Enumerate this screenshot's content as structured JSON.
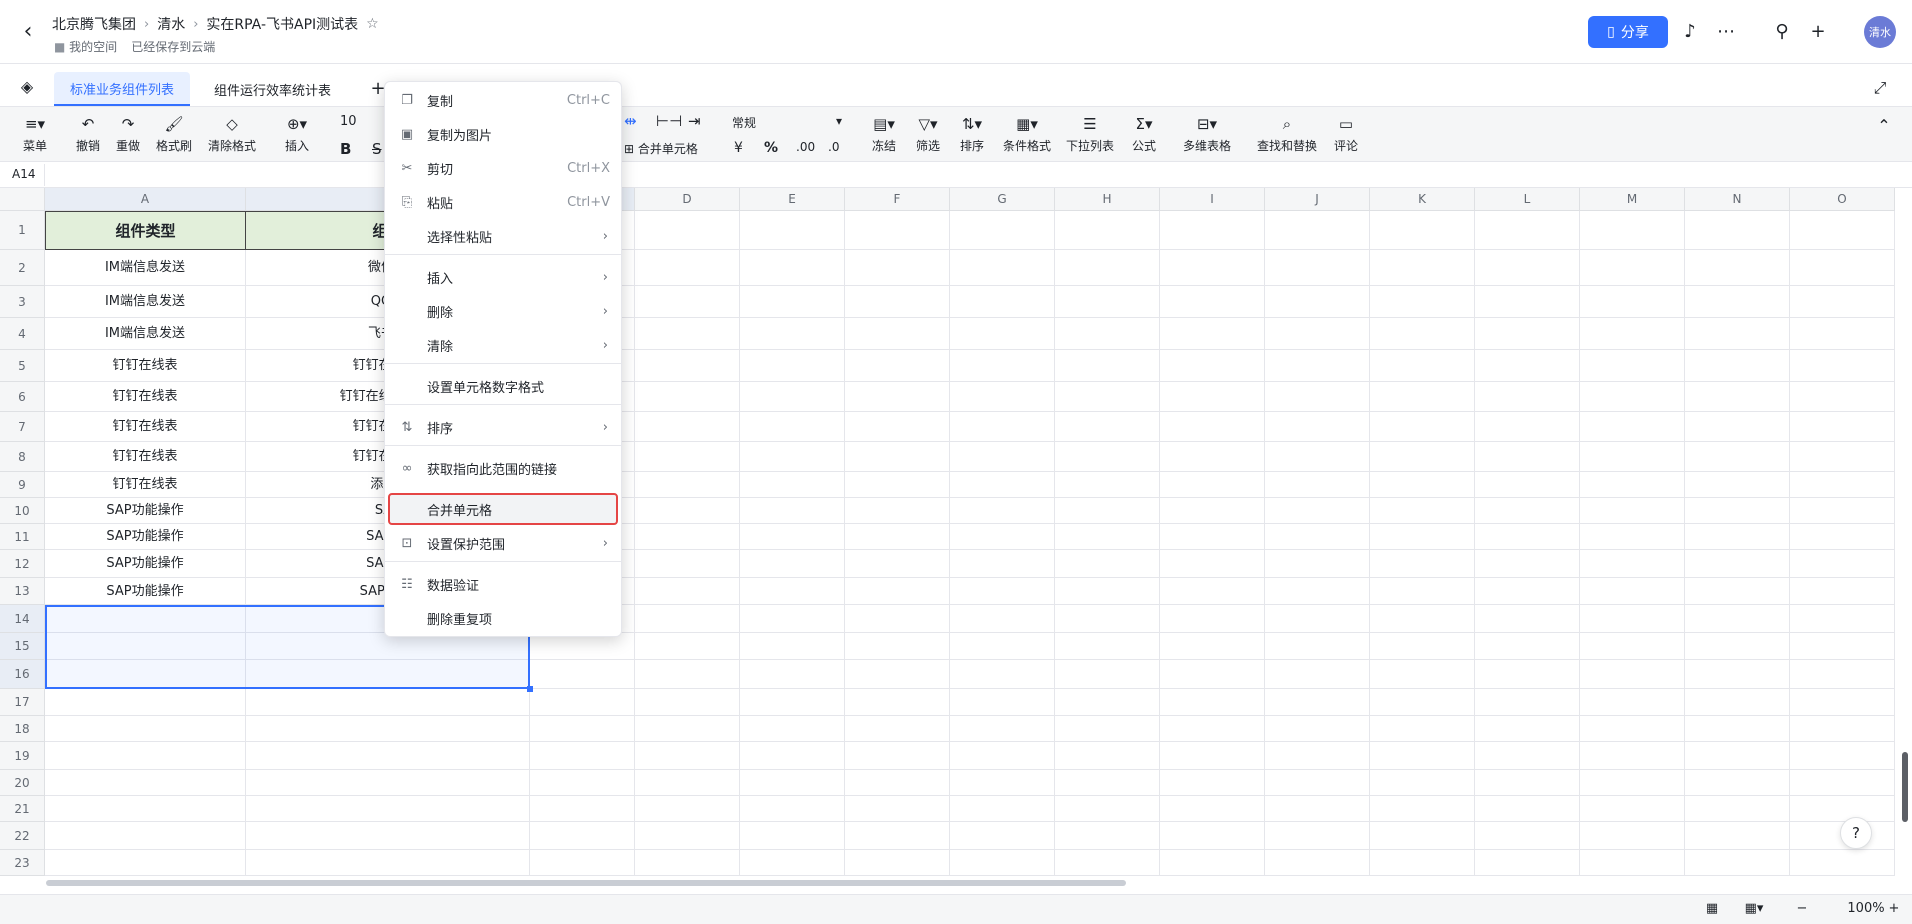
{
  "header": {
    "breadcrumbs": [
      "北京腾飞集团",
      "清水",
      "实在RPA-飞书API测试表"
    ],
    "sub_location": "我的空间",
    "save_status": "已经保存到云端",
    "share_label": "分享",
    "avatar_text": "清水"
  },
  "tabs": [
    {
      "label": "标准业务组件列表",
      "active": true
    },
    {
      "label": "组件运行效率统计表",
      "active": false
    }
  ],
  "toolbar": {
    "menu": "菜单",
    "undo": "撤销",
    "redo": "重做",
    "format_painter": "格式刷",
    "clear_format": "清除格式",
    "insert": "插入",
    "font_size": "10",
    "bold": "B",
    "strike": "S",
    "merge": "合并单元格",
    "number_format": "常规",
    "currency": "¥",
    "percent": "%",
    "freeze": "冻结",
    "filter": "筛选",
    "sort": "排序",
    "cond_format": "条件格式",
    "dropdown": "下拉列表",
    "formula": "公式",
    "multi_table": "多维表格",
    "find_replace": "查找和替换",
    "comment": "评论"
  },
  "formula_bar": {
    "cell_ref": "A14"
  },
  "grid": {
    "columns": [
      "A",
      "",
      "",
      "D",
      "E",
      "F",
      "G",
      "H",
      "I",
      "J",
      "K",
      "L",
      "M",
      "N",
      "O"
    ],
    "rows": [
      "1",
      "2",
      "3",
      "4",
      "5",
      "6",
      "7",
      "8",
      "9",
      "10",
      "11",
      "12",
      "13",
      "14",
      "15",
      "16",
      "17",
      "18",
      "19",
      "20",
      "21",
      "22",
      "23"
    ],
    "header_row": {
      "a": "组件类型",
      "b": "组件"
    },
    "data": [
      {
        "a": "IM端信息发送",
        "b": "微信消"
      },
      {
        "a": "IM端信息发送",
        "b": "QQ消"
      },
      {
        "a": "IM端信息发送",
        "b": "飞书消"
      },
      {
        "a": "钉钉在线表",
        "b": "钉钉在线表-"
      },
      {
        "a": "钉钉在线表",
        "b": "钉钉在线表-获取"
      },
      {
        "a": "钉钉在线表",
        "b": "钉钉在线表-"
      },
      {
        "a": "钉钉在线表",
        "b": "钉钉在线表-"
      },
      {
        "a": "钉钉在线表",
        "b": "添加S"
      },
      {
        "a": "SAP功能操作",
        "b": "SAP"
      },
      {
        "a": "SAP功能操作",
        "b": "SAP-获"
      },
      {
        "a": "SAP功能操作",
        "b": "SAP-执"
      },
      {
        "a": "SAP功能操作",
        "b": "SAP-表格"
      }
    ]
  },
  "context_menu": {
    "items": [
      {
        "label": "复制",
        "shortcut": "Ctrl+C",
        "icon": "copy-icon"
      },
      {
        "label": "复制为图片",
        "shortcut": "",
        "icon": "image-icon"
      },
      {
        "label": "剪切",
        "shortcut": "Ctrl+X",
        "icon": "scissors-icon"
      },
      {
        "label": "粘贴",
        "shortcut": "Ctrl+V",
        "icon": "paste-icon"
      },
      {
        "label": "选择性粘贴",
        "submenu": true
      },
      {
        "label": "插入",
        "submenu": true
      },
      {
        "label": "删除",
        "submenu": true
      },
      {
        "label": "清除",
        "submenu": true
      },
      {
        "label": "设置单元格数字格式"
      },
      {
        "label": "排序",
        "submenu": true,
        "icon": "sort-icon"
      },
      {
        "label": "获取指向此范围的链接",
        "icon": "link-icon"
      },
      {
        "label": "合并单元格",
        "highlighted": true
      },
      {
        "label": "设置保护范围",
        "submenu": true,
        "icon": "lock-icon"
      },
      {
        "label": "数据验证",
        "icon": "validation-icon"
      },
      {
        "label": "删除重复项"
      }
    ]
  },
  "statusbar": {
    "zoom": "100%"
  },
  "colors": {
    "accent": "#3370ff",
    "header_fill": "#e2efda",
    "highlight_border": "#e54545"
  }
}
